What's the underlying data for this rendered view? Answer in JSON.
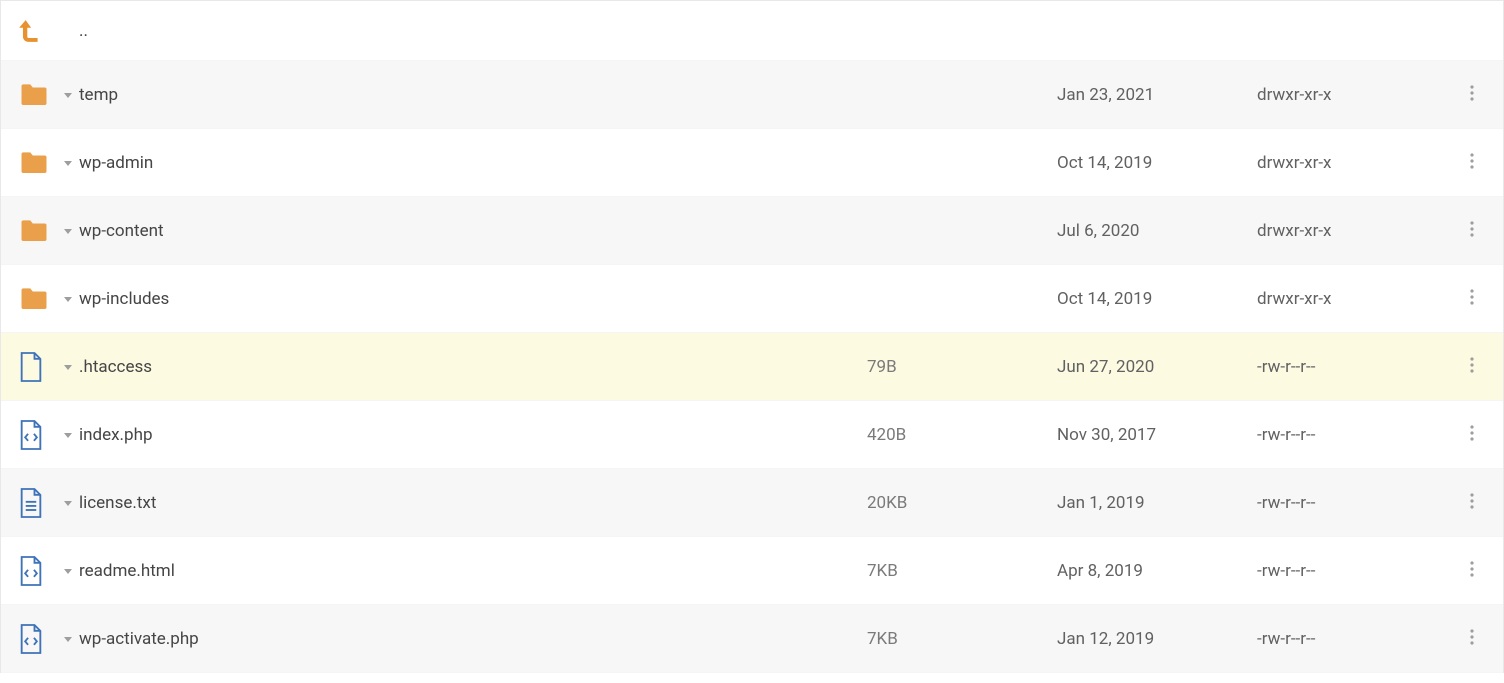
{
  "parent": {
    "label": ".."
  },
  "rows": [
    {
      "type": "folder",
      "name": "temp",
      "size": "",
      "date": "Jan 23, 2021",
      "perm": "drwxr-xr-x",
      "highlight": false
    },
    {
      "type": "folder",
      "name": "wp-admin",
      "size": "",
      "date": "Oct 14, 2019",
      "perm": "drwxr-xr-x",
      "highlight": false
    },
    {
      "type": "folder",
      "name": "wp-content",
      "size": "",
      "date": "Jul 6, 2020",
      "perm": "drwxr-xr-x",
      "highlight": false
    },
    {
      "type": "folder",
      "name": "wp-includes",
      "size": "",
      "date": "Oct 14, 2019",
      "perm": "drwxr-xr-x",
      "highlight": false
    },
    {
      "type": "file",
      "name": ".htaccess",
      "size": "79B",
      "date": "Jun 27, 2020",
      "perm": "-rw-r--r--",
      "highlight": true
    },
    {
      "type": "filecode",
      "name": "index.php",
      "size": "420B",
      "date": "Nov 30, 2017",
      "perm": "-rw-r--r--",
      "highlight": false
    },
    {
      "type": "filetext",
      "name": "license.txt",
      "size": "20KB",
      "date": "Jan 1, 2019",
      "perm": "-rw-r--r--",
      "highlight": false
    },
    {
      "type": "filecode",
      "name": "readme.html",
      "size": "7KB",
      "date": "Apr 8, 2019",
      "perm": "-rw-r--r--",
      "highlight": false
    },
    {
      "type": "filecode",
      "name": "wp-activate.php",
      "size": "7KB",
      "date": "Jan 12, 2019",
      "perm": "-rw-r--r--",
      "highlight": false
    }
  ]
}
